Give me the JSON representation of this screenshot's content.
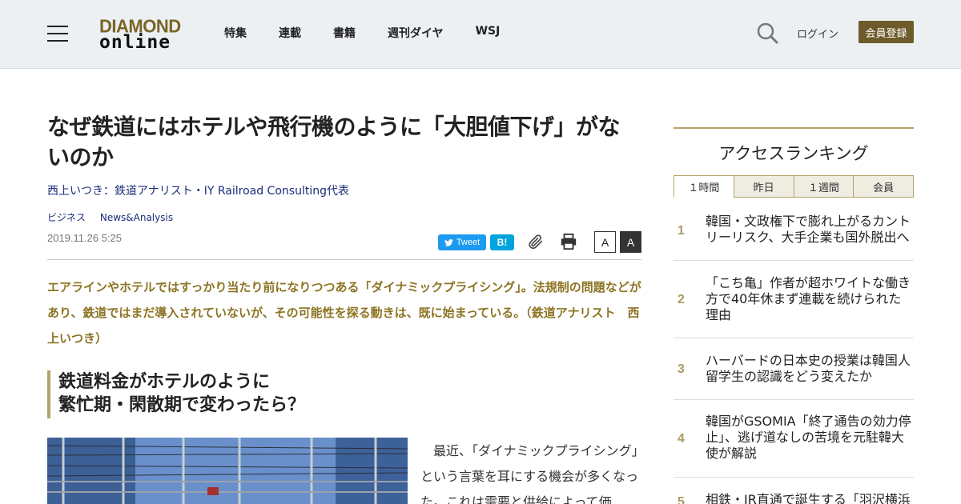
{
  "header": {
    "logo_top": "DIAMOND",
    "logo_bottom": "online",
    "nav": [
      "特集",
      "連載",
      "書籍",
      "週刊ダイヤ",
      "WSJ"
    ],
    "login": "ログイン",
    "register": "会員登録"
  },
  "article": {
    "title": "なぜ鉄道にはホテルや飛行機のように「大胆値下げ」がないのか",
    "author": "西上いつき：鉄道アナリスト・IY Railroad Consulting代表",
    "tags": [
      "ビジネス",
      "News&Analysis"
    ],
    "date": "2019.11.26 5:25",
    "share": {
      "tweet": "Tweet",
      "hatena": "B!",
      "font_small": "A",
      "font_large": "A"
    },
    "lead": "エアラインやホテルではすっかり当たり前になりつつある「ダイナミックプライシング」。法規制の問題などがあり、鉄道ではまだ導入されていないが、その可能性を探る動きは、既に始まっている。（鉄道アナリスト　西上いつき）",
    "subhead_line1": "鉄道料金がホテルのように",
    "subhead_line2": "繁忙期・閑散期で変わったら？",
    "body": "最近、「ダイナミックプライシング」という言葉を耳にする機会が多くなった。これは需要と供給によって価"
  },
  "sidebar": {
    "title": "アクセスランキング",
    "tabs": [
      "１時間",
      "昨日",
      "１週間",
      "会員"
    ],
    "ranking": [
      {
        "rank": "1",
        "text": "韓国・文政権下で膨れ上がるカントリーリスク、大手企業も国外脱出へ"
      },
      {
        "rank": "2",
        "text": "「こち亀」作者が超ホワイトな働き方で40年休まず連載を続けられた理由"
      },
      {
        "rank": "3",
        "text": "ハーバードの日本史の授業は韓国人留学生の認識をどう変えたか"
      },
      {
        "rank": "4",
        "text": "韓国がGSOMIA「終了通告の効力停止」、逃げ道なしの苦境を元駐韓大使が解説"
      },
      {
        "rank": "5",
        "text": "相鉄・JR直通で誕生する「羽沢横浜"
      }
    ]
  },
  "colors": {
    "brand_gold": "#6e5b2c",
    "lead_gold": "#8c7423",
    "link_blue": "#1a2d7a"
  }
}
